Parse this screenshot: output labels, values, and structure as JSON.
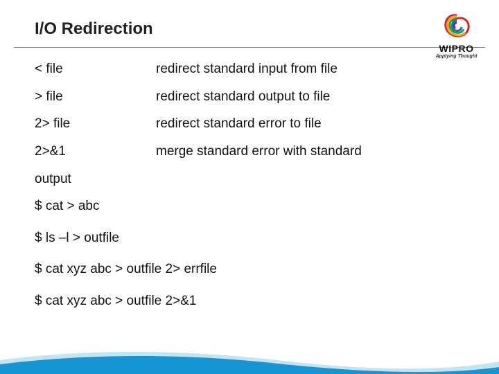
{
  "title": "I/O Redirection",
  "logo": {
    "brand": "WIPRO",
    "tagline": "Applying Thought"
  },
  "rows": [
    {
      "syntax": "< file",
      "desc": "redirect standard input from file"
    },
    {
      "syntax": "> file",
      "desc": "redirect standard output to file"
    },
    {
      "syntax": "2> file",
      "desc": "redirect standard error to file"
    },
    {
      "syntax": "2>&1",
      "desc": "merge standard error with standard"
    }
  ],
  "trailing": "output",
  "examples": [
    "$ cat > abc",
    "$ ls –l > outfile",
    "$ cat xyz abc > outfile 2> errfile",
    "$ cat xyz abc > outfile 2>&1"
  ]
}
